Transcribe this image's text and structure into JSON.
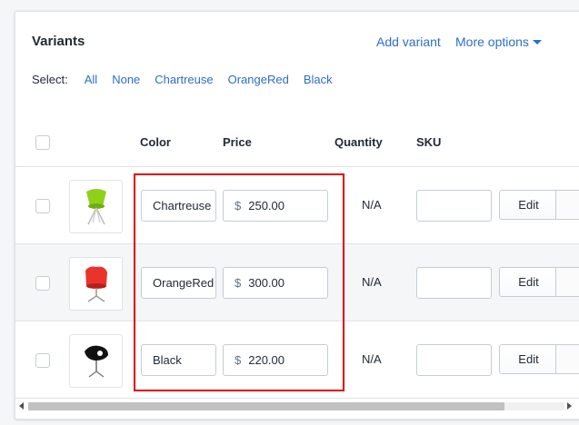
{
  "card": {
    "title": "Variants",
    "add_variant": "Add variant",
    "more_options": "More options"
  },
  "select": {
    "label": "Select:",
    "options": [
      "All",
      "None",
      "Chartreuse",
      "OrangeRed",
      "Black"
    ]
  },
  "table": {
    "headers": {
      "color": "Color",
      "price": "Price",
      "quantity": "Quantity",
      "sku": "SKU"
    },
    "rows": [
      {
        "color": "Chartreuse",
        "currency": "$",
        "price": "250.00",
        "quantity": "N/A",
        "sku": "",
        "edit": "Edit",
        "chair_color": "#8fd11a"
      },
      {
        "color": "OrangeRed",
        "currency": "$",
        "price": "300.00",
        "quantity": "N/A",
        "sku": "",
        "edit": "Edit",
        "chair_color": "#e8342a"
      },
      {
        "color": "Black",
        "currency": "$",
        "price": "220.00",
        "quantity": "N/A",
        "sku": "",
        "edit": "Edit",
        "chair_color": "#111111"
      }
    ]
  },
  "colors": {
    "link": "#2c6ecb",
    "highlight": "#e00000"
  }
}
